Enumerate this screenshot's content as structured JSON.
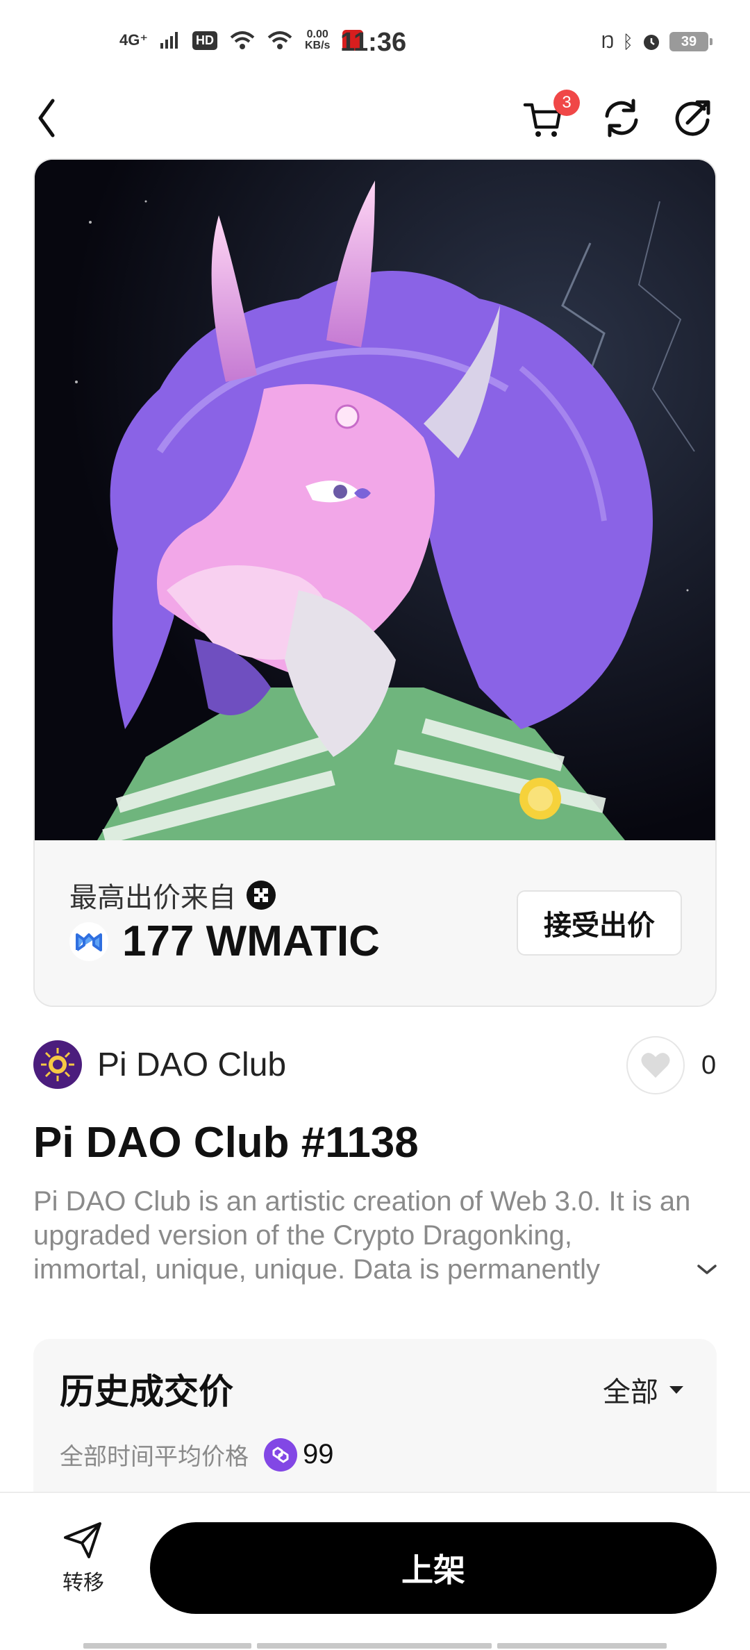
{
  "status_bar": {
    "network": "4G⁺",
    "hd": "HD",
    "speed_value": "0.00",
    "speed_unit": "KB/s",
    "time": "11:36",
    "battery": "39"
  },
  "header": {
    "cart_count": "3"
  },
  "offer": {
    "from_label": "最高出价来自",
    "price": "177 WMATIC",
    "accept_label": "接受出价"
  },
  "collection": {
    "name": "Pi DAO Club",
    "likes": "0"
  },
  "nft": {
    "title": "Pi DAO Club #1138",
    "description": "Pi DAO Club is an artistic creation of Web 3.0. It is an upgraded version of the Crypto Dragonking, immortal, unique, unique. Data is permanently"
  },
  "history": {
    "title": "历史成交价",
    "filter": "全部",
    "avg_label": "全部时间平均价格",
    "avg_value": "99"
  },
  "bottom": {
    "transfer_label": "转移",
    "list_label": "上架"
  },
  "colors": {
    "accent": "#000000",
    "badge": "#f04747",
    "polygon": "#8247e5",
    "art_bg": "#0b0b16",
    "art_hair": "#8a63e6",
    "art_face": "#f2a7e8"
  }
}
